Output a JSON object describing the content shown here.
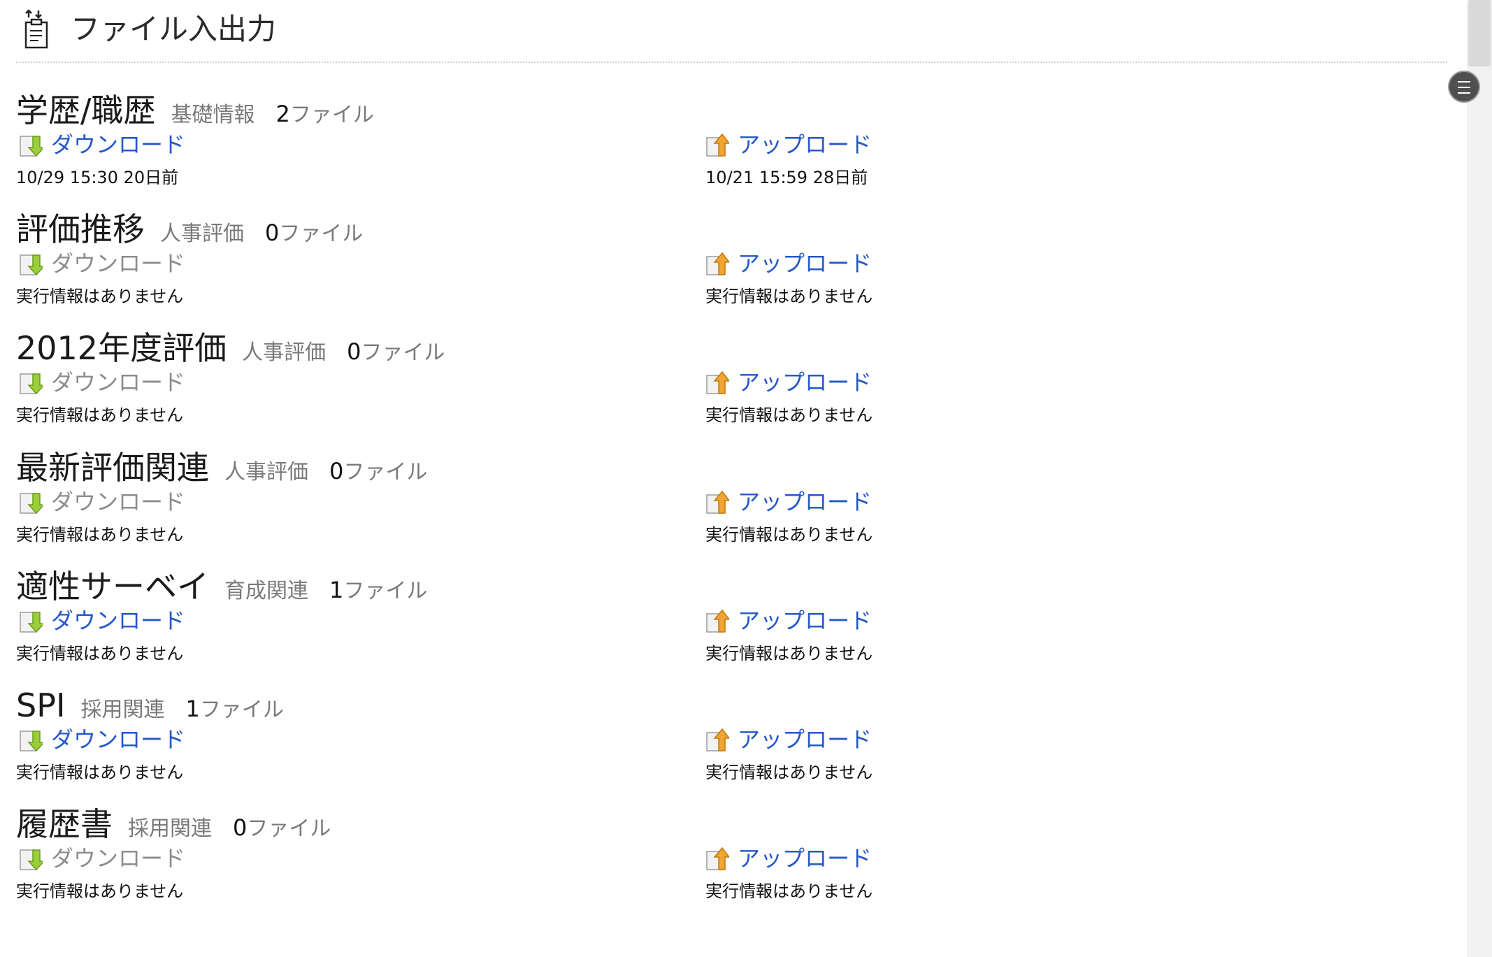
{
  "header": {
    "title": "ファイル入出力",
    "icon": "file-transfer-icon"
  },
  "sections": [
    {
      "title": "学歴/職歴",
      "category": "基礎情報",
      "count": "2",
      "count_suffix": "ファイル",
      "download": {
        "label": "ダウンロード",
        "enabled": true,
        "info": "10/29 15:30 20日前"
      },
      "upload": {
        "label": "アップロード",
        "enabled": true,
        "info": "10/21 15:59 28日前"
      }
    },
    {
      "title": "評価推移",
      "category": "人事評価",
      "count": "0",
      "count_suffix": "ファイル",
      "download": {
        "label": "ダウンロード",
        "enabled": false,
        "info": "実行情報はありません"
      },
      "upload": {
        "label": "アップロード",
        "enabled": true,
        "info": "実行情報はありません"
      }
    },
    {
      "title": "2012年度評価",
      "category": "人事評価",
      "count": "0",
      "count_suffix": "ファイル",
      "download": {
        "label": "ダウンロード",
        "enabled": false,
        "info": "実行情報はありません"
      },
      "upload": {
        "label": "アップロード",
        "enabled": true,
        "info": "実行情報はありません"
      }
    },
    {
      "title": "最新評価関連",
      "category": "人事評価",
      "count": "0",
      "count_suffix": "ファイル",
      "download": {
        "label": "ダウンロード",
        "enabled": false,
        "info": "実行情報はありません"
      },
      "upload": {
        "label": "アップロード",
        "enabled": true,
        "info": "実行情報はありません"
      }
    },
    {
      "title": "適性サーベイ",
      "category": "育成関連",
      "count": "1",
      "count_suffix": "ファイル",
      "download": {
        "label": "ダウンロード",
        "enabled": true,
        "info": "実行情報はありません"
      },
      "upload": {
        "label": "アップロード",
        "enabled": true,
        "info": "実行情報はありません"
      }
    },
    {
      "title": "SPI",
      "category": "採用関連",
      "count": "1",
      "count_suffix": "ファイル",
      "download": {
        "label": "ダウンロード",
        "enabled": true,
        "info": "実行情報はありません"
      },
      "upload": {
        "label": "アップロード",
        "enabled": true,
        "info": "実行情報はありません"
      }
    },
    {
      "title": "履歴書",
      "category": "採用関連",
      "count": "0",
      "count_suffix": "ファイル",
      "download": {
        "label": "ダウンロード",
        "enabled": false,
        "info": "実行情報はありません"
      },
      "upload": {
        "label": "アップロード",
        "enabled": true,
        "info": "実行情報はありません"
      }
    }
  ],
  "icons": {
    "download": "download-file-icon",
    "upload": "upload-file-icon",
    "menu": "hamburger-menu-icon"
  },
  "colors": {
    "link": "#2458c9",
    "disabled": "#8c8c8c",
    "category": "#7a7a7a"
  }
}
